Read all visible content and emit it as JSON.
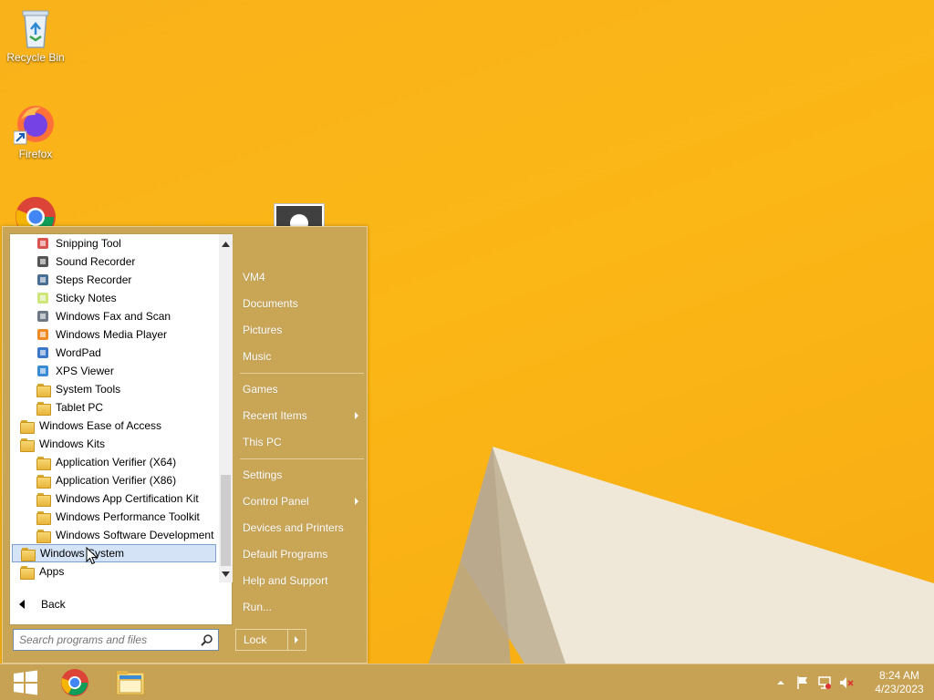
{
  "desktop": {
    "icons": [
      {
        "label": "Recycle Bin"
      },
      {
        "label": "Firefox"
      },
      {
        "label": ""
      }
    ]
  },
  "start_menu": {
    "programs": [
      {
        "label": "Snipping Tool",
        "icon": "scissors-icon",
        "indent": 2
      },
      {
        "label": "Sound Recorder",
        "icon": "microphone-icon",
        "indent": 2
      },
      {
        "label": "Steps Recorder",
        "icon": "steps-recorder-icon",
        "indent": 2
      },
      {
        "label": "Sticky Notes",
        "icon": "sticky-note-icon",
        "indent": 2
      },
      {
        "label": "Windows Fax and Scan",
        "icon": "fax-icon",
        "indent": 2
      },
      {
        "label": "Windows Media Player",
        "icon": "media-player-icon",
        "indent": 2
      },
      {
        "label": "WordPad",
        "icon": "wordpad-icon",
        "indent": 2
      },
      {
        "label": "XPS Viewer",
        "icon": "xps-viewer-icon",
        "indent": 2
      },
      {
        "label": "System Tools",
        "icon": "folder-icon",
        "indent": 2
      },
      {
        "label": "Tablet PC",
        "icon": "folder-icon",
        "indent": 2
      },
      {
        "label": "Windows Ease of Access",
        "icon": "folder-icon",
        "indent": 1
      },
      {
        "label": "Windows Kits",
        "icon": "folder-icon",
        "indent": 1
      },
      {
        "label": "Application Verifier (X64)",
        "icon": "folder-icon",
        "indent": 2
      },
      {
        "label": "Application Verifier (X86)",
        "icon": "folder-icon",
        "indent": 2
      },
      {
        "label": "Windows App Certification Kit",
        "icon": "folder-icon",
        "indent": 2
      },
      {
        "label": "Windows Performance Toolkit",
        "icon": "folder-icon",
        "indent": 2
      },
      {
        "label": "Windows Software Development Kit",
        "icon": "folder-icon",
        "indent": 2
      },
      {
        "label": "Windows System",
        "icon": "folder-icon",
        "indent": 1,
        "selected": true
      },
      {
        "label": "Apps",
        "icon": "apps-folder-icon",
        "indent": 1
      }
    ],
    "back_label": "Back",
    "search_placeholder": "Search programs and files",
    "right_items": [
      {
        "label": "VM4",
        "submenu": false
      },
      {
        "label": "Documents",
        "submenu": false
      },
      {
        "label": "Pictures",
        "submenu": false
      },
      {
        "label": "Music",
        "submenu": false
      },
      {
        "label": "Games",
        "submenu": false
      },
      {
        "label": "Recent Items",
        "submenu": true
      },
      {
        "label": "This PC",
        "submenu": false
      },
      {
        "label": "Settings",
        "submenu": false
      },
      {
        "label": "Control Panel",
        "submenu": true
      },
      {
        "label": "Devices and Printers",
        "submenu": false
      },
      {
        "label": "Default Programs",
        "submenu": false
      },
      {
        "label": "Help and Support",
        "submenu": false
      },
      {
        "label": "Run...",
        "submenu": false
      }
    ],
    "lock_label": "Lock"
  },
  "taskbar": {
    "clock_time": "8:24 AM",
    "clock_date": "4/23/2023"
  },
  "colors": {
    "accent": "#c9a556",
    "wallpaper": "#fbb716",
    "selection": "#d5e3f7"
  }
}
